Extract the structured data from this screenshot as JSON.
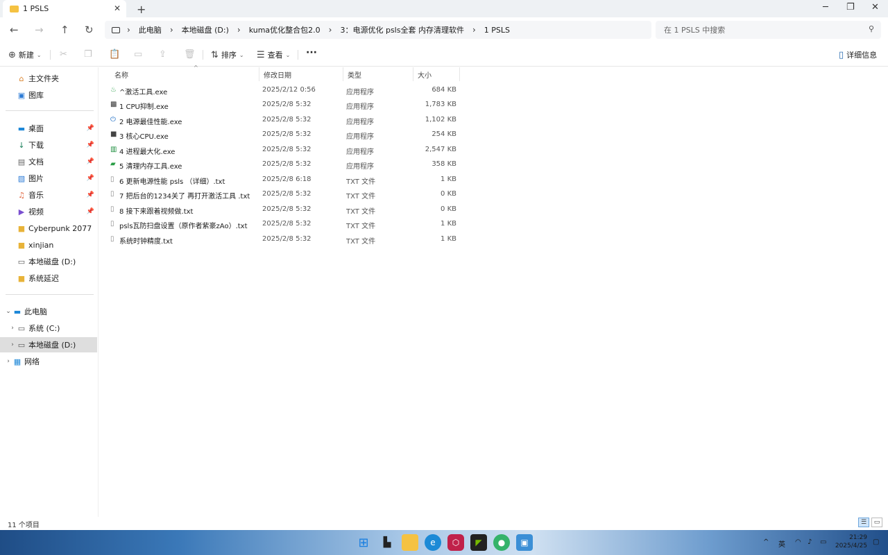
{
  "window": {
    "tab_title": "1 PSLS",
    "tab_close": "✕",
    "new_tab": "+",
    "minimize": "─",
    "restore": "❐",
    "close": "✕"
  },
  "nav": {
    "back": "←",
    "forward": "→",
    "up": "↑",
    "refresh": "↻"
  },
  "breadcrumb": [
    "此电脑",
    "本地磁盘 (D:)",
    "kuma优化整合包2.0",
    "3：电源优化 psls全套 内存清理软件",
    "1 PSLS"
  ],
  "breadcrumb_sep": "›",
  "search": {
    "placeholder": "在 1 PSLS 中搜索",
    "icon": "search-icon"
  },
  "toolbar": {
    "new_label": "新建",
    "sort_label": "排序",
    "view_label": "查看",
    "more_label": "···",
    "details_label": "详细信息"
  },
  "sidebar": {
    "quick": [
      {
        "label": "主文件夹",
        "icon": "home-icon"
      },
      {
        "label": "图库",
        "icon": "gallery-icon"
      }
    ],
    "pinned": [
      {
        "label": "桌面",
        "icon": "desktop-icon"
      },
      {
        "label": "下载",
        "icon": "download-icon"
      },
      {
        "label": "文档",
        "icon": "document-icon"
      },
      {
        "label": "图片",
        "icon": "pictures-icon"
      },
      {
        "label": "音乐",
        "icon": "music-icon"
      },
      {
        "label": "视频",
        "icon": "video-icon"
      }
    ],
    "folders": [
      {
        "label": "Cyberpunk 2077",
        "icon": "folder-icon"
      },
      {
        "label": "xinjian",
        "icon": "folder-icon"
      },
      {
        "label": "本地磁盘 (D:)",
        "icon": "drive-icon"
      },
      {
        "label": "系统延迟",
        "icon": "folder-icon"
      }
    ],
    "tree": {
      "this_pc": "此电脑",
      "drive_c": "系统 (C:)",
      "drive_d": "本地磁盘 (D:)",
      "network": "网络"
    }
  },
  "columns": {
    "name": "名称",
    "date": "修改日期",
    "type": "类型",
    "size": "大小"
  },
  "files": [
    {
      "name": "^激活工具.exe",
      "date": "2025/2/12 0:56",
      "type": "应用程序",
      "size": "684 KB",
      "icon": "flame-icon"
    },
    {
      "name": "1 CPU抑制.exe",
      "date": "2025/2/8 5:32",
      "type": "应用程序",
      "size": "1,783 KB",
      "icon": "cpu-icon"
    },
    {
      "name": "2 电源最佳性能.exe",
      "date": "2025/2/8 5:32",
      "type": "应用程序",
      "size": "1,102 KB",
      "icon": "power-icon"
    },
    {
      "name": "3 核心CPU.exe",
      "date": "2025/2/8 5:32",
      "type": "应用程序",
      "size": "254 KB",
      "icon": "chip-icon"
    },
    {
      "name": "4 进程最大化.exe",
      "date": "2025/2/8 5:32",
      "type": "应用程序",
      "size": "2,547 KB",
      "icon": "bar-chart-icon"
    },
    {
      "name": "5 清理内存工具.exe",
      "date": "2025/2/8 5:32",
      "type": "应用程序",
      "size": "358 KB",
      "icon": "memory-icon"
    },
    {
      "name": "6 更新电源性能 psls （详细）.txt",
      "date": "2025/2/8 6:18",
      "type": "TXT 文件",
      "size": "1 KB",
      "icon": "text-file-icon"
    },
    {
      "name": "7 把后台的1234关了 再打开激活工具 .txt",
      "date": "2025/2/8 5:32",
      "type": "TXT 文件",
      "size": "0 KB",
      "icon": "text-file-icon"
    },
    {
      "name": "8 接下来跟着视频做.txt",
      "date": "2025/2/8 5:32",
      "type": "TXT 文件",
      "size": "0 KB",
      "icon": "text-file-icon"
    },
    {
      "name": "psls瓦防扫盘设置（原作者紫豪zAo）.txt",
      "date": "2025/2/8 5:32",
      "type": "TXT 文件",
      "size": "1 KB",
      "icon": "text-file-icon"
    },
    {
      "name": "系统时钟精度.txt",
      "date": "2025/2/8 5:32",
      "type": "TXT 文件",
      "size": "1 KB",
      "icon": "text-file-icon"
    }
  ],
  "status": {
    "count": "11 个项目"
  },
  "taskbar": {
    "tray_lang": "英",
    "time": "21:29",
    "date": "2025/4/25"
  }
}
